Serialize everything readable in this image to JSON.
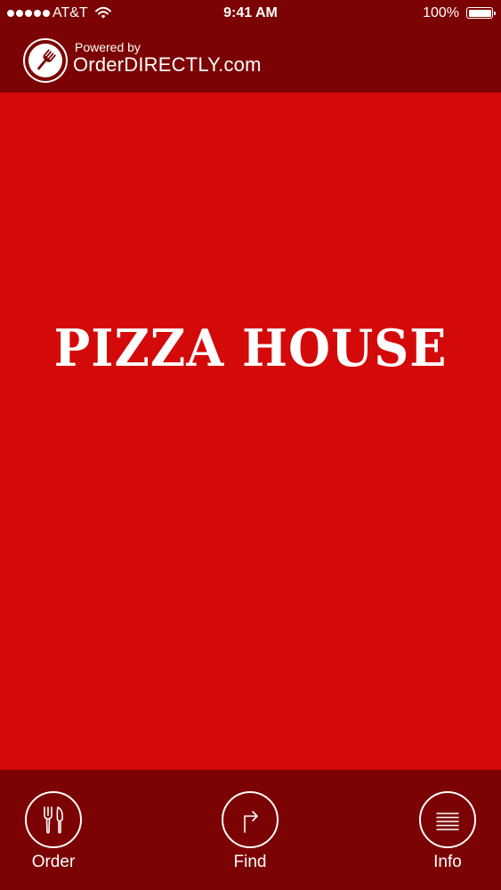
{
  "status_bar": {
    "carrier": "AT&T",
    "time": "9:41 AM",
    "battery": "100%",
    "battery_level": 1.0
  },
  "header": {
    "powered_by": "Powered by",
    "brand": "OrderDIRECTLY.com",
    "logo_icon": "fork-icon"
  },
  "hero": {
    "title": "PIZZA HOUSE",
    "background": "#d40909"
  },
  "tabbar": {
    "background": "#7c0303",
    "tabs": [
      {
        "label": "Order",
        "icon": "cutlery-icon"
      },
      {
        "label": "Find",
        "icon": "turn-arrow-icon"
      },
      {
        "label": "Info",
        "icon": "lines-icon"
      }
    ]
  },
  "colors": {
    "dark_red": "#7c0303",
    "red": "#d40909",
    "white": "#ffffff"
  }
}
